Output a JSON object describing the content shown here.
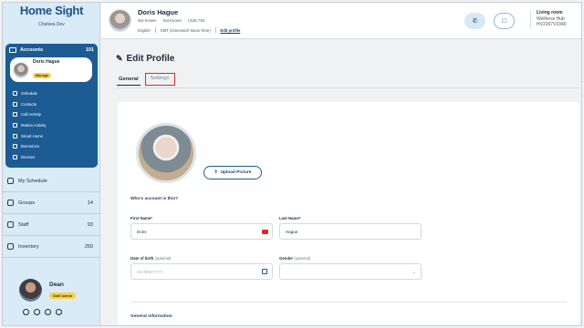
{
  "app": {
    "logo": "Home Sight",
    "org": "Chelsea Dev"
  },
  "sidebar": {
    "accounts": {
      "label": "Accounts",
      "count": "101"
    },
    "profile": {
      "name": "Doris Hague",
      "role": "Manage"
    },
    "items": [
      {
        "label": "Schedule",
        "icon": "calendar-icon"
      },
      {
        "label": "Contacts",
        "icon": "contacts-icon"
      },
      {
        "label": "Call Activity",
        "icon": "phone-icon"
      },
      {
        "label": "Motion Activity",
        "icon": "motion-icon"
      },
      {
        "label": "Smart Home",
        "icon": "home-icon"
      },
      {
        "label": "Biometrics",
        "icon": "heart-icon"
      },
      {
        "label": "Devices",
        "icon": "device-icon"
      }
    ],
    "sections": [
      {
        "label": "My Schedule",
        "count": ""
      },
      {
        "label": "Groups",
        "count": "14"
      },
      {
        "label": "Staff",
        "count": "93"
      },
      {
        "label": "Inventory",
        "count": "250"
      }
    ],
    "user": {
      "name": "Dean",
      "role": "Staff Admin"
    }
  },
  "header": {
    "name": "Doris Hague",
    "meta": [
      "Not Known",
      "Not Known",
      "LS25 7JN"
    ],
    "language": "English",
    "timezone": "GMT (Greenwich Mean Time)",
    "edit_link": "Edit profile",
    "room": {
      "title": "Living room",
      "hub": "Wellness Hub",
      "id": "HV2267V3340"
    }
  },
  "main": {
    "title": "Edit Profile",
    "tabs": [
      {
        "label": "General",
        "active": true
      },
      {
        "label": "Settings",
        "active": false
      }
    ],
    "upload_label": "Upload Picture",
    "section_question": "Who's account is this?",
    "fields": {
      "first_name": {
        "label": "First Name*",
        "value": "Doris"
      },
      "last_name": {
        "label": "Last Name*",
        "value": "Hague"
      },
      "dob": {
        "label": "Date of birth",
        "optional": "(optional)",
        "placeholder": "DD/MM/YYYY"
      },
      "gender": {
        "label": "Gender",
        "optional": "(optional)",
        "value": ""
      }
    },
    "general_info": "General information"
  },
  "colors": {
    "accent": "#1d5b93",
    "sidebar_bg": "#d9ebf7",
    "badge": "#f5d24b",
    "highlight": "#d62d2d"
  }
}
